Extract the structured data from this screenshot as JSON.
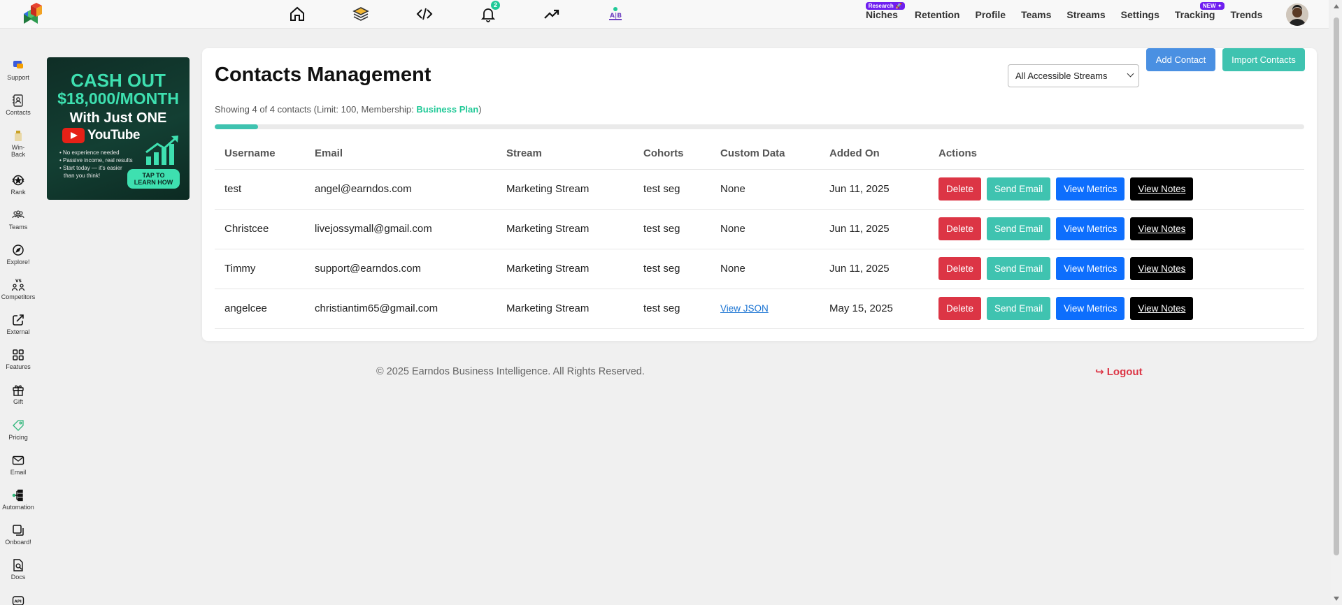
{
  "topnav": {
    "icons": [
      "home-icon",
      "layers-icon",
      "code-icon",
      "bell-icon",
      "trending-up-icon",
      "ab-test-icon"
    ],
    "notification_count": "2",
    "links": [
      {
        "label": "Niches",
        "tag": "Research 🚀"
      },
      {
        "label": "Retention",
        "tag": ""
      },
      {
        "label": "Profile",
        "tag": ""
      },
      {
        "label": "Teams",
        "tag": ""
      },
      {
        "label": "Streams",
        "tag": ""
      },
      {
        "label": "Settings",
        "tag": ""
      },
      {
        "label": "Tracking",
        "tag": "NEW ✦"
      },
      {
        "label": "Trends",
        "tag": ""
      }
    ]
  },
  "sidebar": {
    "items": [
      {
        "label": "Support",
        "icon": "support-icon"
      },
      {
        "label": "Contacts",
        "icon": "contacts-icon"
      },
      {
        "label": "Win-Back",
        "icon": "win-back-icon"
      },
      {
        "label": "Rank",
        "icon": "rank-icon"
      },
      {
        "label": "Teams",
        "icon": "teams-icon"
      },
      {
        "label": "Explore!",
        "icon": "explore-icon"
      },
      {
        "label": "Competitors",
        "icon": "competitors-icon"
      },
      {
        "label": "External",
        "icon": "external-icon"
      },
      {
        "label": "Features",
        "icon": "features-icon"
      },
      {
        "label": "Gift",
        "icon": "gift-icon"
      },
      {
        "label": "Pricing",
        "icon": "pricing-icon"
      },
      {
        "label": "Email",
        "icon": "email-icon"
      },
      {
        "label": "Automation",
        "icon": "automation-icon"
      },
      {
        "label": "Onboard!",
        "icon": "onboard-icon"
      },
      {
        "label": "Docs",
        "icon": "docs-icon"
      },
      {
        "label": "API",
        "icon": "api-icon"
      }
    ]
  },
  "ad": {
    "line1": "CASH OUT",
    "line2": "$18,000/MONTH",
    "line3": "With Just ONE",
    "brand": "YouTube",
    "bullet1": "• No experience needed",
    "bullet2": "• Passive income, real results",
    "bullet3a": "• Start today — it's easier",
    "bullet3b": "than you think!",
    "cta1": "TAP TO",
    "cta2": "LEARN HOW"
  },
  "main": {
    "title": "Contacts Management",
    "stream_select": "All Accessible Streams",
    "add_contact": "Add Contact",
    "import_contacts": "Import Contacts",
    "showing_prefix": "Showing 4 of 4 contacts (Limit: 100, Membership: ",
    "plan": "Business Plan",
    "showing_suffix": ")",
    "usage_fraction": 0.04,
    "colors": {
      "delete": "#dc3545",
      "send": "#3fc3b0",
      "metrics": "#0d6efd",
      "notes": "#000000",
      "accent": "#20c997"
    }
  },
  "table": {
    "headers": [
      "Username",
      "Email",
      "Stream",
      "Cohorts",
      "Custom Data",
      "Added On",
      "Actions"
    ],
    "rows": [
      {
        "username": "test",
        "email": "angel@earndos.com",
        "stream": "Marketing Stream",
        "cohorts": "test seg",
        "custom": "None",
        "added": "Jun 11, 2025"
      },
      {
        "username": "Christcee",
        "email": "livejossymall@gmail.com",
        "stream": "Marketing Stream",
        "cohorts": "test seg",
        "custom": "None",
        "added": "Jun 11, 2025"
      },
      {
        "username": "Timmy",
        "email": "support@earndos.com",
        "stream": "Marketing Stream",
        "cohorts": "test seg",
        "custom": "None",
        "added": "Jun 11, 2025"
      },
      {
        "username": "angelcee",
        "email": "christiantim65@gmail.com",
        "stream": "Marketing Stream",
        "cohorts": "test seg",
        "custom": "View JSON",
        "added": "May 15, 2025"
      }
    ],
    "actions": {
      "delete": "Delete",
      "send": "Send Email",
      "metrics": "View Metrics",
      "notes": "View Notes"
    }
  },
  "footer": {
    "copyright": "© 2025 Earndos Business Intelligence. All Rights Reserved.",
    "logout": "Logout"
  }
}
